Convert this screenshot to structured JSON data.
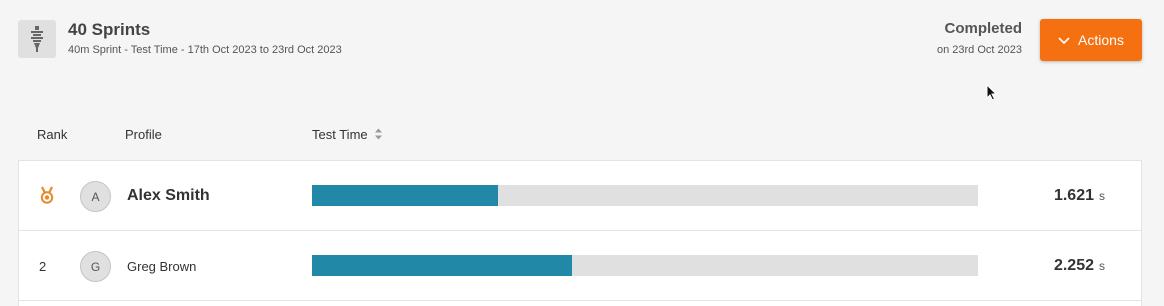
{
  "header": {
    "title": "40 Sprints",
    "subtitle": "40m Sprint - Test Time - 17th Oct 2023 to 23rd Oct 2023",
    "icon": "test-tube-icon",
    "status": "Completed",
    "status_date": "on 23rd Oct 2023"
  },
  "actions": {
    "label": "Actions",
    "icon": "chevron-down-icon",
    "color": "#f57010"
  },
  "table": {
    "columns": {
      "rank": "Rank",
      "profile": "Profile",
      "metric": "Test Time"
    },
    "bar_color": "#2188a8",
    "track_color": "#e0e0e0",
    "rows": [
      {
        "rank": "",
        "rank_icon": "medal-icon",
        "initial": "A",
        "name": "Alex Smith",
        "value": "1.621",
        "unit": "s",
        "fill": 0.28
      },
      {
        "rank": "2",
        "initial": "G",
        "name": "Greg Brown",
        "value": "2.252",
        "unit": "s",
        "fill": 0.39
      }
    ]
  }
}
